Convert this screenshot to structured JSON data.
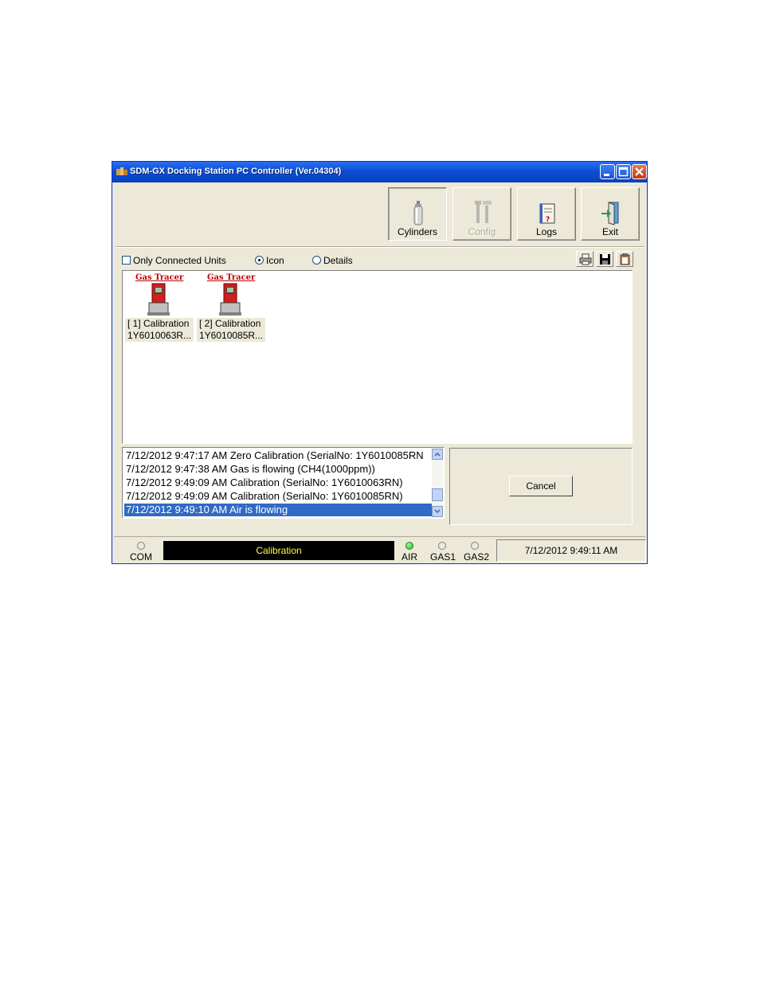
{
  "window": {
    "title": "SDM-GX Docking Station PC Controller (Ver.04304)"
  },
  "toolbar": {
    "buttons": [
      {
        "label": "Cylinders",
        "icon": "cylinder-icon",
        "state": "pressed"
      },
      {
        "label": "Config",
        "icon": "tools-icon",
        "state": "disabled"
      },
      {
        "label": "Logs",
        "icon": "logbook-icon",
        "state": "normal"
      },
      {
        "label": "Exit",
        "icon": "exit-door-icon",
        "state": "normal"
      }
    ]
  },
  "view_options": {
    "only_connected_label": "Only Connected Units",
    "only_connected_checked": false,
    "icon_label": "Icon",
    "details_label": "Details",
    "selected_view": "Icon",
    "action_icons": [
      "printer-icon",
      "save-icon",
      "clipboard-icon"
    ]
  },
  "units": [
    {
      "brand": "Gas Tracer",
      "status": "[ 1] Calibration",
      "serial": "1Y6010063R..."
    },
    {
      "brand": "Gas Tracer",
      "status": "[ 2] Calibration",
      "serial": "1Y6010085R..."
    }
  ],
  "log": {
    "entries": [
      "7/12/2012 9:47:17 AM Zero Calibration (SerialNo: 1Y6010085RN",
      "7/12/2012 9:47:38 AM Gas is flowing (CH4(1000ppm))",
      "7/12/2012 9:49:09 AM Calibration (SerialNo: 1Y6010063RN)",
      "7/12/2012 9:49:09 AM Calibration (SerialNo: 1Y6010085RN)",
      "7/12/2012 9:49:10 AM Air is flowing"
    ],
    "selected_index": 4
  },
  "actions": {
    "cancel_label": "Cancel"
  },
  "status": {
    "com_label": "COM",
    "message": "Calibration",
    "air_label": "AIR",
    "gas1_label": "GAS1",
    "gas2_label": "GAS2",
    "air_on": true,
    "datetime": "7/12/2012 9:49:11 AM",
    "message_color": "#ffff3c",
    "led_on_color": "#22b322"
  }
}
